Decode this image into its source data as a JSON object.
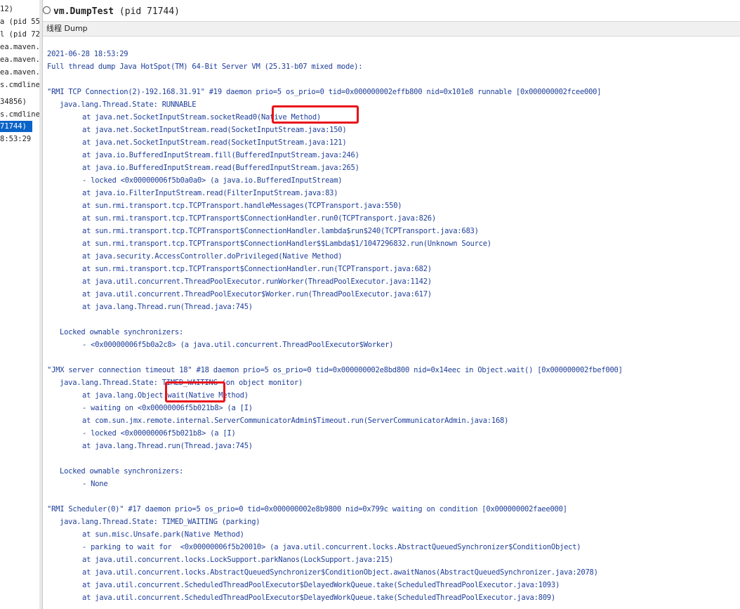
{
  "window": {
    "title_name": "vm.DumpTest",
    "title_pid": " (pid 71744)"
  },
  "tabs": [
    {
      "label": "线程 Dump"
    }
  ],
  "sidebar": {
    "items": [
      {
        "label": "12)"
      },
      {
        "label": "a (pid 55"
      },
      {
        "label": "l (pid 72"
      },
      {
        "label": "ea.maven."
      },
      {
        "label": "ea.maven."
      },
      {
        "label": "ea.maven."
      },
      {
        "label": "s.cmdline"
      },
      {
        "label": "34856)"
      },
      {
        "label": "s.cmdline"
      },
      {
        "label": "71744)"
      },
      {
        "label": "8:53:29"
      }
    ]
  },
  "dump": {
    "timestamp": "2021-06-28 18:53:29",
    "header": "Full thread dump Java HotSpot(TM) 64-Bit Server VM (25.31-b07 mixed mode):",
    "threads": [
      {
        "header": "\"RMI TCP Connection(2)-192.168.31.91\" #19 daemon prio=5 os_prio=0 tid=0x000000002effb800 nid=0x101e8 runnable [0x000000002fcee000]",
        "state": "java.lang.Thread.State: RUNNABLE",
        "frames": [
          "at java.net.SocketInputStream.socketRead0(Native Method)",
          "at java.net.SocketInputStream.read(SocketInputStream.java:150)",
          "at java.net.SocketInputStream.read(SocketInputStream.java:121)",
          "at java.io.BufferedInputStream.fill(BufferedInputStream.java:246)",
          "at java.io.BufferedInputStream.read(BufferedInputStream.java:265)",
          "- locked <0x00000006f5b0a0a0> (a java.io.BufferedInputStream)",
          "at java.io.FilterInputStream.read(FilterInputStream.java:83)",
          "at sun.rmi.transport.tcp.TCPTransport.handleMessages(TCPTransport.java:550)",
          "at sun.rmi.transport.tcp.TCPTransport$ConnectionHandler.run0(TCPTransport.java:826)",
          "at sun.rmi.transport.tcp.TCPTransport$ConnectionHandler.lambda$run$240(TCPTransport.java:683)",
          "at sun.rmi.transport.tcp.TCPTransport$ConnectionHandler$$Lambda$1/1047296832.run(Unknown Source)",
          "at java.security.AccessController.doPrivileged(Native Method)",
          "at sun.rmi.transport.tcp.TCPTransport$ConnectionHandler.run(TCPTransport.java:682)",
          "at java.util.concurrent.ThreadPoolExecutor.runWorker(ThreadPoolExecutor.java:1142)",
          "at java.util.concurrent.ThreadPoolExecutor$Worker.run(ThreadPoolExecutor.java:617)",
          "at java.lang.Thread.run(Thread.java:745)"
        ],
        "sync_title": "Locked ownable synchronizers:",
        "sync_items": [
          "- <0x00000006f5b0a2c8> (a java.util.concurrent.ThreadPoolExecutor$Worker)"
        ]
      },
      {
        "header": "\"JMX server connection timeout 18\" #18 daemon prio=5 os_prio=0 tid=0x000000002e8bd800 nid=0x14eec in Object.wait() [0x000000002fbef000]",
        "state": "java.lang.Thread.State: TIMED_WAITING (on object monitor)",
        "frames": [
          "at java.lang.Object.wait(Native Method)",
          "- waiting on <0x00000006f5b021b8> (a [I)",
          "at com.sun.jmx.remote.internal.ServerCommunicatorAdmin$Timeout.run(ServerCommunicatorAdmin.java:168)",
          "- locked <0x00000006f5b021b8> (a [I)",
          "at java.lang.Thread.run(Thread.java:745)"
        ],
        "sync_title": "Locked ownable synchronizers:",
        "sync_items": [
          "- None"
        ]
      },
      {
        "header": "\"RMI Scheduler(0)\" #17 daemon prio=5 os_prio=0 tid=0x000000002e8b9800 nid=0x799c waiting on condition [0x000000002faee000]",
        "state": "java.lang.Thread.State: TIMED_WAITING (parking)",
        "frames": [
          "at sun.misc.Unsafe.park(Native Method)",
          "- parking to wait for  <0x00000006f5b20010> (a java.util.concurrent.locks.AbstractQueuedSynchronizer$ConditionObject)",
          "at java.util.concurrent.locks.LockSupport.parkNanos(LockSupport.java:215)",
          "at java.util.concurrent.locks.AbstractQueuedSynchronizer$ConditionObject.awaitNanos(AbstractQueuedSynchronizer.java:2078)",
          "at java.util.concurrent.ScheduledThreadPoolExecutor$DelayedWorkQueue.take(ScheduledThreadPoolExecutor.java:1093)",
          "at java.util.concurrent.ScheduledThreadPoolExecutor$DelayedWorkQueue.take(ScheduledThreadPoolExecutor.java:809)"
        ],
        "sync_title": "",
        "sync_items": []
      }
    ]
  },
  "colors": {
    "text": "#1f3f9a",
    "highlight_box": "#e8111a",
    "selection": "#0a64c8"
  }
}
